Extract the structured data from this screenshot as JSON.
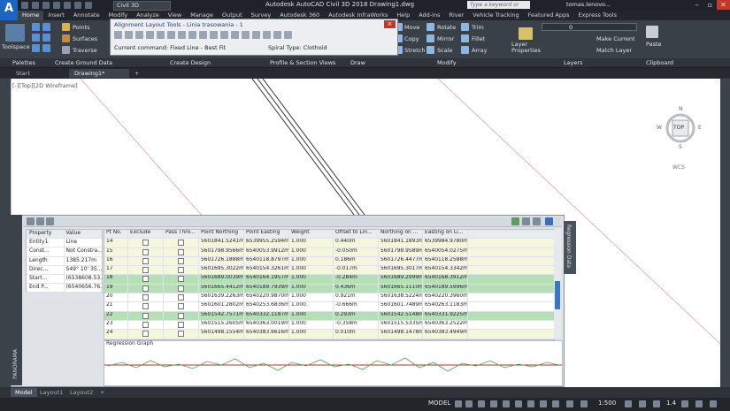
{
  "app": {
    "logo_letter": "A",
    "workspace": "Civil 3D",
    "title": "Autodesk AutoCAD Civil 3D 2018   Drawing1.dwg",
    "search_placeholder": "Type a keyword or phrase",
    "user": "tomas.lenovo..."
  },
  "ribbon_tabs": [
    "Home",
    "Insert",
    "Annotate",
    "Modify",
    "Analyze",
    "View",
    "Manage",
    "Output",
    "Survey",
    "Autodesk 360",
    "Autodesk InfraWorks",
    "Help",
    "Add-ins",
    "River",
    "Vehicle Tracking",
    "Featured Apps",
    "Express Tools"
  ],
  "ribbon": {
    "toolspace": "Toolspace",
    "points": "Points",
    "surfaces": "Surfaces",
    "traverse": "Traverse",
    "move": "Move",
    "copy": "Copy",
    "stretch": "Stretch",
    "rotate": "Rotate",
    "mirror": "Mirror",
    "scale": "Scale",
    "trim": "Trim",
    "fillet": "Fillet",
    "array": "Array",
    "layer_properties": "Layer Properties",
    "layer_value": "0",
    "make_current": "Make Current",
    "match_layer": "Match Layer",
    "paste": "Paste"
  },
  "panels": [
    "Palettes",
    "Create Ground Data",
    "Create Design",
    "Profile & Section Views",
    "Draw",
    "Modify",
    "Layers",
    "Clipboard"
  ],
  "alignment_tools": {
    "title": "Alignment Layout Tools - Linia trasowania - 1",
    "command": "Current command: Fixed Line - Best Fit",
    "spiral": "Spiral Type: Clothoid",
    "close": "×"
  },
  "file_tabs": [
    "Start",
    "Drawing1*"
  ],
  "view_label": "[-][Top][2D Wireframe]",
  "viewcube": {
    "top": "TOP",
    "n": "N",
    "s": "S",
    "e": "E",
    "w": "W",
    "wcs": "WCS"
  },
  "regression": {
    "side_label": "PANORAMA",
    "property_headers": [
      "Property",
      "Value"
    ],
    "properties": [
      [
        "Entity1",
        "Line"
      ],
      [
        "Const...",
        "Not Constra..."
      ],
      [
        "Length",
        "1385.217m"
      ],
      [
        "Direc...",
        "S49° 10' 35..."
      ],
      [
        "Start...",
        "(6538608.53..."
      ],
      [
        "End P...",
        "(6540656.76..."
      ]
    ],
    "grid_headers": [
      "Pt No.",
      "Exclude",
      "Pass Thro...",
      "Point Northing",
      "Point Easting",
      "Weight",
      "Offset to Lin...",
      "Northing on ...",
      "Easting on Li..."
    ],
    "rows": [
      [
        "14",
        "",
        "",
        "5601841.5241m",
        "6539955.2594m",
        "1.000",
        "0.440m",
        "5601841.1893m",
        "6539984.9780m"
      ],
      [
        "15",
        "",
        "",
        "5601798.9566m",
        "6540053.9912m",
        "1.000",
        "-0.050m",
        "5601798.9589m",
        "6540054.0275m"
      ],
      [
        "16",
        "",
        "",
        "5601726.1888m",
        "6540118.8797m",
        "1.000",
        "0.186m",
        "5601726.4477m",
        "6540118.2588m"
      ],
      [
        "17",
        "",
        "",
        "5601695.3022m",
        "6540154.3261m",
        "1.000",
        "-0.017m",
        "5601695.3017m",
        "6540154.3342m"
      ],
      [
        "18",
        "",
        "",
        "5601689.0039m",
        "6540164.1957m",
        "1.000",
        "-0.284m",
        "5601689.2999m",
        "6540168.3912m"
      ],
      [
        "19",
        "",
        "",
        "5601665.4412m",
        "6540189.7939m",
        "1.000",
        "0.436m",
        "5601665.1110m",
        "6540189.5996m"
      ],
      [
        "20",
        "",
        "",
        "5601639.2263m",
        "6540220.9870m",
        "1.000",
        "0.921m",
        "5601638.5224m",
        "6540220.3960m"
      ],
      [
        "21",
        "",
        "",
        "5601601.2802m",
        "6540253.6836m",
        "1.000",
        "-0.666m",
        "5601601.7489m",
        "6540263.1183m"
      ],
      [
        "22",
        "",
        "",
        "5601542.7571m",
        "6540332.1187m",
        "1.000",
        "0.293m",
        "5601542.5148m",
        "6540331.9225m"
      ],
      [
        "23",
        "",
        "",
        "5601515.2605m",
        "6540363.0019m",
        "1.000",
        "-0.358m",
        "5601515.5335m",
        "6540363.2522m"
      ],
      [
        "24",
        "",
        "",
        "5601498.1554m",
        "6540383.6616m",
        "1.000",
        "0.010m",
        "5601498.1478m",
        "6540383.4949m"
      ]
    ],
    "graph_title": "Regression Graph",
    "right_tab": "Regression Data"
  },
  "layout_tabs": [
    "Model",
    "Layout1",
    "Layout2",
    "+"
  ],
  "status": {
    "model": "MODEL",
    "scale": "1:500",
    "zoom": "1.4"
  }
}
